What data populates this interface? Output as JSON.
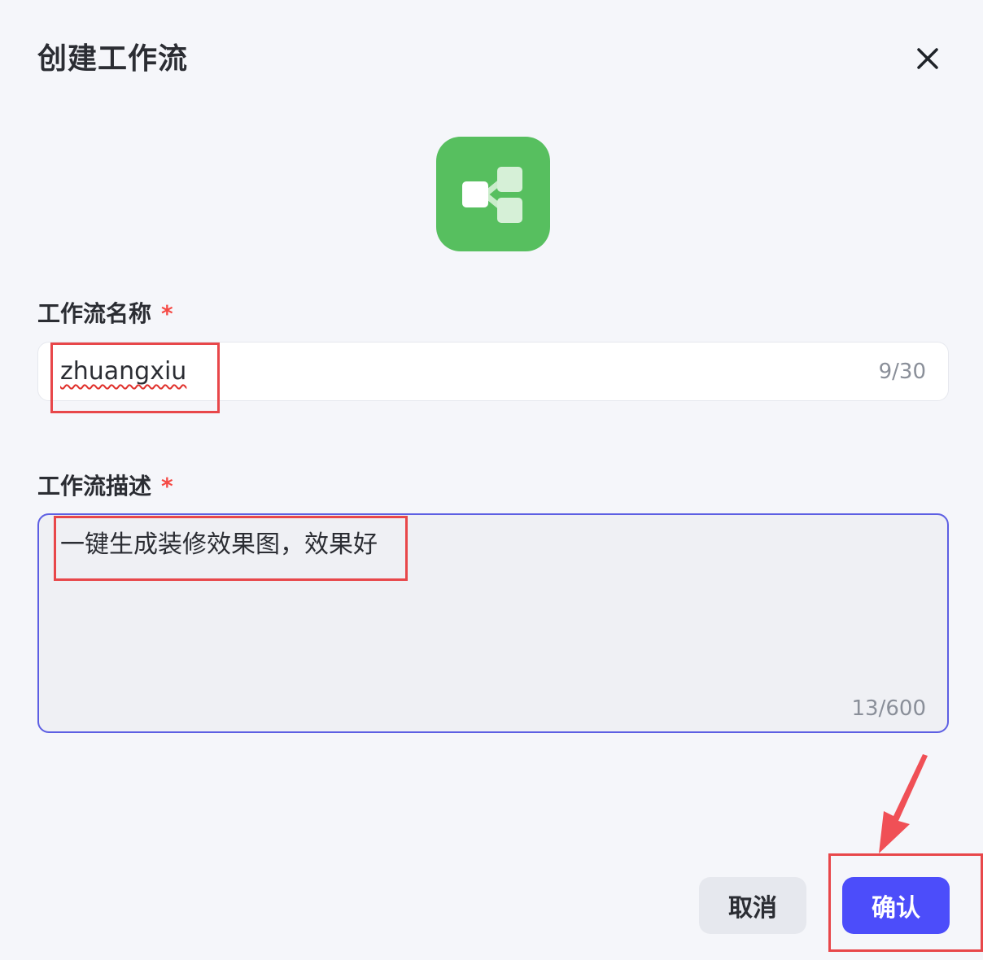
{
  "dialog": {
    "title": "创建工作流",
    "close_icon": "close-icon",
    "workflow_icon": "workflow-branch-icon",
    "icon_color": "#57bf5f"
  },
  "name_field": {
    "label": "工作流名称",
    "required_mark": "*",
    "value": "zhuangxiu",
    "counter": "9/30"
  },
  "desc_field": {
    "label": "工作流描述",
    "required_mark": "*",
    "value": "一键生成装修效果图，效果好",
    "counter": "13/600"
  },
  "actions": {
    "cancel_label": "取消",
    "confirm_label": "确认"
  },
  "colors": {
    "primary": "#4c4dfa",
    "required": "#f54a45",
    "annotation": "#e8474a",
    "focus_border": "#5d5fe3"
  }
}
